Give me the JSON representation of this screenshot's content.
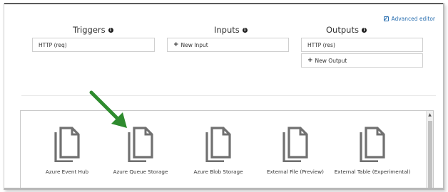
{
  "header": {
    "advanced_editor_label": "Advanced editor"
  },
  "columns": {
    "triggers": {
      "title": "Triggers",
      "items": [
        {
          "label": "HTTP (req)"
        }
      ]
    },
    "inputs": {
      "title": "Inputs",
      "new_label": "New Input"
    },
    "outputs": {
      "title": "Outputs",
      "items": [
        {
          "label": "HTTP (res)"
        }
      ],
      "new_label": "New Output"
    }
  },
  "templates": [
    {
      "label": "Azure Event Hub",
      "icon": "document-stack-icon"
    },
    {
      "label": "Azure Queue Storage",
      "icon": "document-stack-icon"
    },
    {
      "label": "Azure Blob Storage",
      "icon": "document-stack-icon"
    },
    {
      "label": "External File (Preview)",
      "icon": "document-stack-icon"
    },
    {
      "label": "External Table (Experimental)",
      "icon": "document-stack-icon"
    }
  ],
  "colors": {
    "link": "#2a6fb0",
    "arrow": "#2e8b2e",
    "icon": "#707070"
  }
}
